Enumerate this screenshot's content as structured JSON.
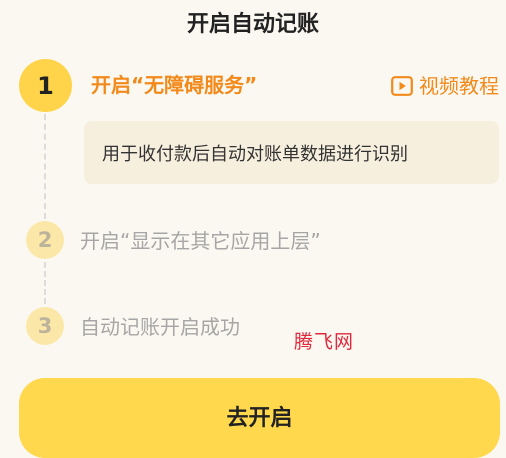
{
  "header": {
    "title": "开启自动记账"
  },
  "steps": [
    {
      "number": "1",
      "title": "开启“无障碍服务”",
      "description": "用于收付款后自动对账单数据进行识别",
      "status": "active"
    },
    {
      "number": "2",
      "title": "开启“显示在其它应用上层”",
      "status": "pending"
    },
    {
      "number": "3",
      "title": "自动记账开启成功",
      "status": "pending"
    }
  ],
  "video_link": {
    "label": "视频教程",
    "icon": "play-icon"
  },
  "watermark": "腾飞网",
  "action_button": {
    "label": "去开启"
  },
  "colors": {
    "background": "#FBF8F1",
    "accent_orange": "#F28A1B",
    "active_yellow": "#FFD44A",
    "pending_yellow": "#FBE8A9",
    "description_bg": "#F6EFDE",
    "button_yellow": "#FFD84D",
    "pending_text": "#A6A6A6"
  }
}
